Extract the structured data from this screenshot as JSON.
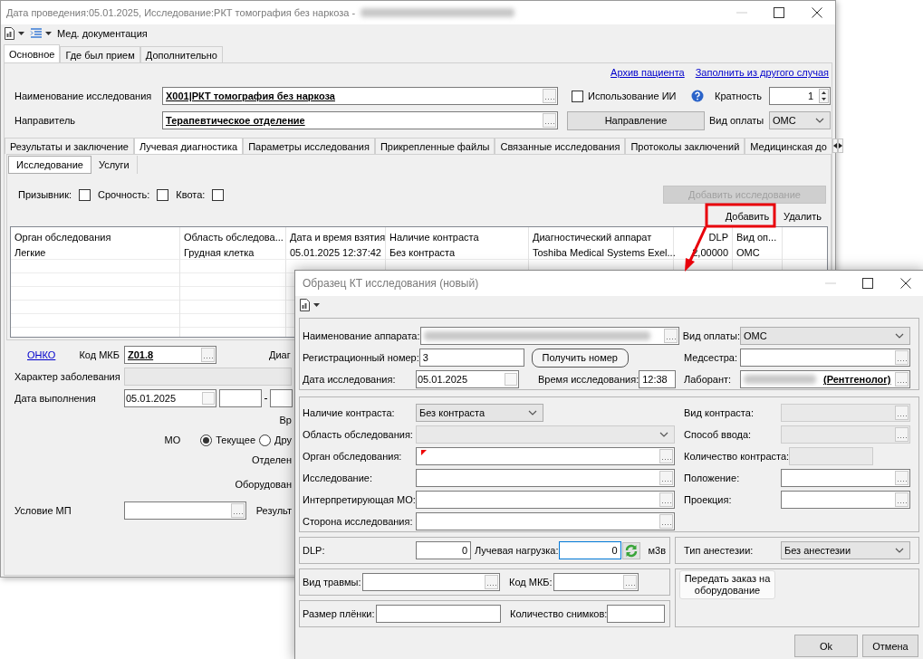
{
  "main_window": {
    "title": "Дата проведения:05.01.2025, Исследование:РКТ томография без наркоза -",
    "toolbar": {
      "label": "Мед. документация"
    },
    "tabs": [
      {
        "label": "Основное",
        "selected": true
      },
      {
        "label": "Где был прием",
        "selected": false
      },
      {
        "label": "Дополнительно",
        "selected": false
      }
    ],
    "links": [
      "Архив пациента",
      "Заполнить из другого случая"
    ],
    "study_name": {
      "label": "Наименование исследования",
      "value": "X001|РКТ томография без наркоза"
    },
    "ai_use": {
      "label": "Использование ИИ",
      "checked": false
    },
    "multiplicity": {
      "label": "Кратность",
      "value": "1"
    },
    "referrer": {
      "label": "Направитель",
      "value": "Терапевтическое отделение"
    },
    "referral_button": "Направление",
    "payment": {
      "label": "Вид оплаты",
      "value": "ОМС"
    },
    "section_tabs": [
      {
        "label": "Результаты и заключение",
        "selected": false
      },
      {
        "label": "Лучевая диагностика",
        "selected": true
      },
      {
        "label": "Параметры исследования",
        "selected": false
      },
      {
        "label": "Прикрепленные файлы",
        "selected": false
      },
      {
        "label": "Связанные исследования",
        "selected": false
      },
      {
        "label": "Протоколы заключений",
        "selected": false
      },
      {
        "label": "Медицинская до",
        "selected": false
      }
    ],
    "sub_tabs": [
      {
        "label": "Исследование",
        "selected": true
      },
      {
        "label": "Услуги",
        "selected": false
      }
    ],
    "flags": [
      {
        "label": "Призывник:",
        "checked": false
      },
      {
        "label": "Срочность:",
        "checked": false
      },
      {
        "label": "Квота:",
        "checked": false
      }
    ],
    "add_study_button": {
      "label": "Добавить исследование",
      "disabled": true
    },
    "grid_actions": [
      "Добавить",
      "Удалить"
    ],
    "table": {
      "columns": [
        "Орган обследования",
        "Область обследова...",
        "Дата и время взятия",
        "Наличие контраста",
        "Диагностический аппарат",
        "DLP",
        "Вид оп..."
      ],
      "rows": [
        [
          "Легкие",
          "Грудная клетка",
          "05.01.2025 12:37:42",
          "Без контраста",
          "Toshiba Medical Systems Exel...",
          "2,00000",
          "ОМС"
        ]
      ]
    },
    "onko_link": "ОНКО",
    "mkb": {
      "label": "Код МКБ",
      "value": "Z01.8"
    },
    "diag_label": "Диаг",
    "disease_character": {
      "label": "Характер заболевания"
    },
    "execution_date": {
      "label": "Дата выполнения",
      "value": "05.01.2025"
    },
    "time_label": "Вр",
    "mo": {
      "label": "МО",
      "options": [
        {
          "label": "Текущее",
          "selected": true
        },
        {
          "label": "Дру",
          "selected": false
        }
      ]
    },
    "department_label": "Отделен",
    "equipment_label": "Оборудован",
    "care_condition": {
      "label": "Условие МП"
    },
    "result_label": "Результ"
  },
  "dialog": {
    "title": "Образец КТ исследования (новый)",
    "device": {
      "label": "Наименование аппарата:"
    },
    "payment": {
      "label": "Вид оплаты:",
      "value": "ОМС"
    },
    "reg_number": {
      "label": "Регистрационный номер:",
      "value": "3"
    },
    "get_number_button": "Получить номер",
    "nurse": {
      "label": "Медсестра:"
    },
    "study_date": {
      "label": "Дата исследования:",
      "value": "05.01.2025"
    },
    "study_time": {
      "label": "Время исследования:",
      "value": "12:38"
    },
    "lab_assistant": {
      "label": "Лаборант:",
      "role": "(Рентгенолог)"
    },
    "left_fields": [
      {
        "kind": "combo",
        "label": "Наличие контраста:",
        "value": "Без контраста",
        "disabled": false
      },
      {
        "kind": "combo",
        "label": "Область обследования:",
        "disabled": true
      },
      {
        "kind": "lookup",
        "label": "Орган обследования:",
        "disabled": false,
        "required": true
      },
      {
        "kind": "lookup",
        "label": "Исследование:",
        "disabled": false,
        "required": false
      },
      {
        "kind": "lookup",
        "label": "Интерпретирующая МО:",
        "disabled": false,
        "required": false
      },
      {
        "kind": "lookup",
        "label": "Сторона исследования:",
        "disabled": false,
        "required": false
      }
    ],
    "right_fields": [
      {
        "kind": "lookup",
        "label": "Вид контраста:",
        "disabled": true
      },
      {
        "kind": "lookup",
        "label": "Способ ввода:",
        "disabled": true
      },
      {
        "kind": "text",
        "label": "Количество контраста:",
        "disabled": true
      },
      {
        "kind": "lookup",
        "label": "Положение:",
        "disabled": false
      },
      {
        "kind": "lookup",
        "label": "Проекция:",
        "disabled": false
      }
    ],
    "dlp": {
      "label": "DLP:",
      "value": "0"
    },
    "radiation_dose": {
      "label": "Лучевая нагрузка:",
      "value": "0",
      "focused": true,
      "unit": "м3в"
    },
    "anesthesia": {
      "label": "Тип анестезии:",
      "value": "Без анестезии"
    },
    "injury_type": {
      "label": "Вид травмы:"
    },
    "mkb": {
      "label": "Код МКБ:"
    },
    "film_size": {
      "label": "Размер плёнки:"
    },
    "image_count": {
      "label": "Количество снимков:"
    },
    "send_order_button": "Передать заказ на оборудование",
    "buttons": [
      "Ok",
      "Отмена"
    ]
  }
}
